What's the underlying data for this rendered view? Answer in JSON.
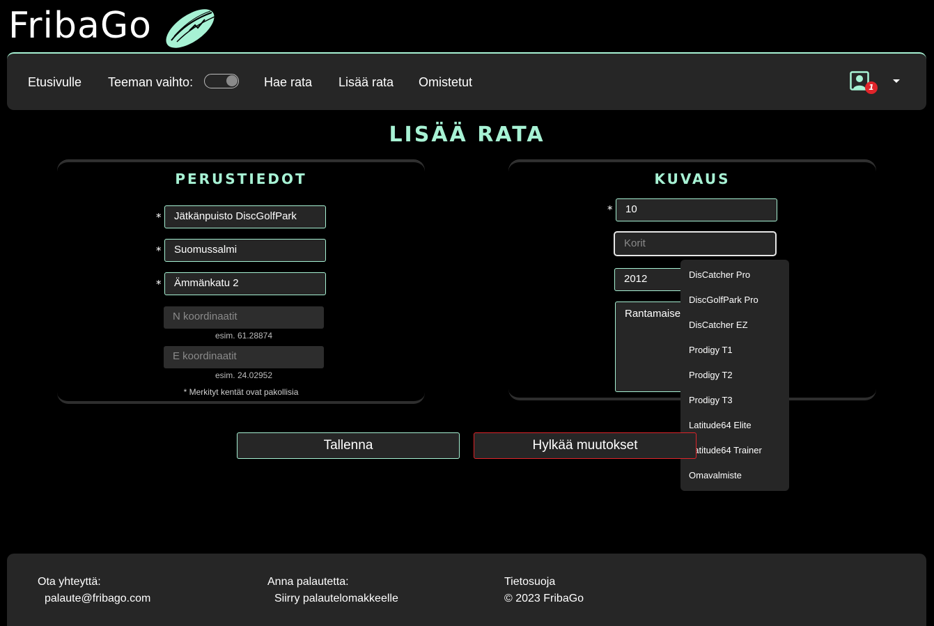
{
  "brand": {
    "name": "FribaGo"
  },
  "nav": {
    "home": "Etusivulle",
    "theme_label": "Teeman vaihto:",
    "search_course": "Hae rata",
    "add_course": "Lisää rata",
    "owned": "Omistetut",
    "notification_count": "1"
  },
  "page": {
    "title": "LISÄÄ RATA"
  },
  "basic_info": {
    "title": "PERUSTIEDOT",
    "name_value": "Jätkänpuisto DiscGolfPark",
    "city_value": "Suomussalmi",
    "address_value": "Ämmänkatu 2",
    "n_coord_placeholder": "N koordinaatit",
    "n_coord_hint": "esim. 61.28874",
    "e_coord_placeholder": "E koordinaatit",
    "e_coord_hint": "esim. 24.02952",
    "required_note": "* Merkityt kentät ovat pakollisia",
    "required_marker": "*"
  },
  "description": {
    "title": "KUVAUS",
    "holes_value": "10",
    "baskets_placeholder": "Korit",
    "year_value": "2012",
    "text_value": "Rantamaise"
  },
  "baskets_dropdown": {
    "options": [
      "DisCatcher Pro",
      "DiscGolfPark Pro",
      "DisCatcher EZ",
      "Prodigy T1",
      "Prodigy T2",
      "Prodigy T3",
      "Latitude64 Elite",
      "Latitude64 Trainer",
      "Omavalmiste"
    ]
  },
  "actions": {
    "save": "Tallenna",
    "discard": "Hylkää muutokset"
  },
  "footer": {
    "contact_label": "Ota yhteyttä:",
    "contact_email": "palaute@fribago.com",
    "feedback_label": "Anna palautetta:",
    "feedback_link": "Siirry palautelomakkeelle",
    "privacy_label": "Tietosuoja",
    "copyright": "© 2023 FribaGo"
  },
  "colors": {
    "accent": "#a7f2d4",
    "danger": "#e0242a",
    "panel": "#262626",
    "background": "#000000"
  },
  "icons": {
    "logo": "flying-disc-logo",
    "user": "user-profile-icon",
    "caret": "caret-down-icon"
  }
}
